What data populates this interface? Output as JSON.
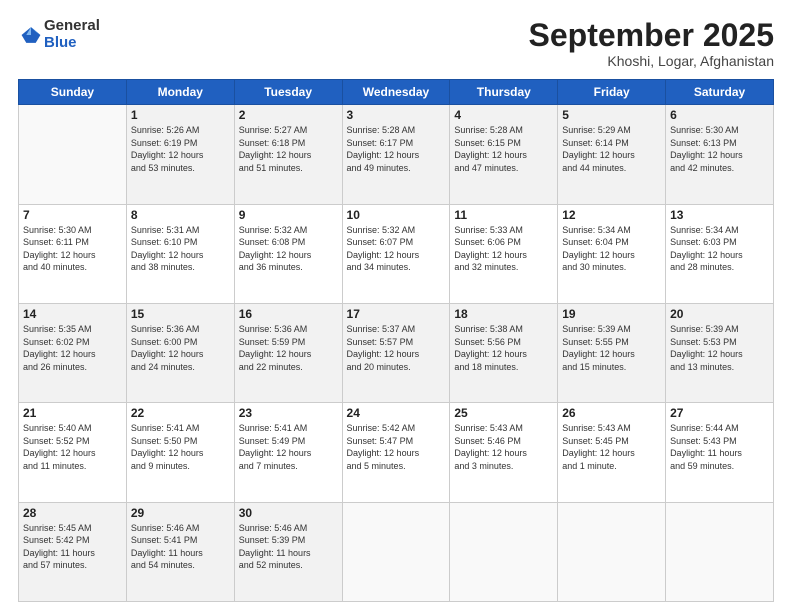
{
  "header": {
    "logo_general": "General",
    "logo_blue": "Blue",
    "month_title": "September 2025",
    "location": "Khoshi, Logar, Afghanistan"
  },
  "days_of_week": [
    "Sunday",
    "Monday",
    "Tuesday",
    "Wednesday",
    "Thursday",
    "Friday",
    "Saturday"
  ],
  "weeks": [
    [
      {
        "day": "",
        "info": ""
      },
      {
        "day": "1",
        "info": "Sunrise: 5:26 AM\nSunset: 6:19 PM\nDaylight: 12 hours\nand 53 minutes."
      },
      {
        "day": "2",
        "info": "Sunrise: 5:27 AM\nSunset: 6:18 PM\nDaylight: 12 hours\nand 51 minutes."
      },
      {
        "day": "3",
        "info": "Sunrise: 5:28 AM\nSunset: 6:17 PM\nDaylight: 12 hours\nand 49 minutes."
      },
      {
        "day": "4",
        "info": "Sunrise: 5:28 AM\nSunset: 6:15 PM\nDaylight: 12 hours\nand 47 minutes."
      },
      {
        "day": "5",
        "info": "Sunrise: 5:29 AM\nSunset: 6:14 PM\nDaylight: 12 hours\nand 44 minutes."
      },
      {
        "day": "6",
        "info": "Sunrise: 5:30 AM\nSunset: 6:13 PM\nDaylight: 12 hours\nand 42 minutes."
      }
    ],
    [
      {
        "day": "7",
        "info": "Sunrise: 5:30 AM\nSunset: 6:11 PM\nDaylight: 12 hours\nand 40 minutes."
      },
      {
        "day": "8",
        "info": "Sunrise: 5:31 AM\nSunset: 6:10 PM\nDaylight: 12 hours\nand 38 minutes."
      },
      {
        "day": "9",
        "info": "Sunrise: 5:32 AM\nSunset: 6:08 PM\nDaylight: 12 hours\nand 36 minutes."
      },
      {
        "day": "10",
        "info": "Sunrise: 5:32 AM\nSunset: 6:07 PM\nDaylight: 12 hours\nand 34 minutes."
      },
      {
        "day": "11",
        "info": "Sunrise: 5:33 AM\nSunset: 6:06 PM\nDaylight: 12 hours\nand 32 minutes."
      },
      {
        "day": "12",
        "info": "Sunrise: 5:34 AM\nSunset: 6:04 PM\nDaylight: 12 hours\nand 30 minutes."
      },
      {
        "day": "13",
        "info": "Sunrise: 5:34 AM\nSunset: 6:03 PM\nDaylight: 12 hours\nand 28 minutes."
      }
    ],
    [
      {
        "day": "14",
        "info": "Sunrise: 5:35 AM\nSunset: 6:02 PM\nDaylight: 12 hours\nand 26 minutes."
      },
      {
        "day": "15",
        "info": "Sunrise: 5:36 AM\nSunset: 6:00 PM\nDaylight: 12 hours\nand 24 minutes."
      },
      {
        "day": "16",
        "info": "Sunrise: 5:36 AM\nSunset: 5:59 PM\nDaylight: 12 hours\nand 22 minutes."
      },
      {
        "day": "17",
        "info": "Sunrise: 5:37 AM\nSunset: 5:57 PM\nDaylight: 12 hours\nand 20 minutes."
      },
      {
        "day": "18",
        "info": "Sunrise: 5:38 AM\nSunset: 5:56 PM\nDaylight: 12 hours\nand 18 minutes."
      },
      {
        "day": "19",
        "info": "Sunrise: 5:39 AM\nSunset: 5:55 PM\nDaylight: 12 hours\nand 15 minutes."
      },
      {
        "day": "20",
        "info": "Sunrise: 5:39 AM\nSunset: 5:53 PM\nDaylight: 12 hours\nand 13 minutes."
      }
    ],
    [
      {
        "day": "21",
        "info": "Sunrise: 5:40 AM\nSunset: 5:52 PM\nDaylight: 12 hours\nand 11 minutes."
      },
      {
        "day": "22",
        "info": "Sunrise: 5:41 AM\nSunset: 5:50 PM\nDaylight: 12 hours\nand 9 minutes."
      },
      {
        "day": "23",
        "info": "Sunrise: 5:41 AM\nSunset: 5:49 PM\nDaylight: 12 hours\nand 7 minutes."
      },
      {
        "day": "24",
        "info": "Sunrise: 5:42 AM\nSunset: 5:47 PM\nDaylight: 12 hours\nand 5 minutes."
      },
      {
        "day": "25",
        "info": "Sunrise: 5:43 AM\nSunset: 5:46 PM\nDaylight: 12 hours\nand 3 minutes."
      },
      {
        "day": "26",
        "info": "Sunrise: 5:43 AM\nSunset: 5:45 PM\nDaylight: 12 hours\nand 1 minute."
      },
      {
        "day": "27",
        "info": "Sunrise: 5:44 AM\nSunset: 5:43 PM\nDaylight: 11 hours\nand 59 minutes."
      }
    ],
    [
      {
        "day": "28",
        "info": "Sunrise: 5:45 AM\nSunset: 5:42 PM\nDaylight: 11 hours\nand 57 minutes."
      },
      {
        "day": "29",
        "info": "Sunrise: 5:46 AM\nSunset: 5:41 PM\nDaylight: 11 hours\nand 54 minutes."
      },
      {
        "day": "30",
        "info": "Sunrise: 5:46 AM\nSunset: 5:39 PM\nDaylight: 11 hours\nand 52 minutes."
      },
      {
        "day": "",
        "info": ""
      },
      {
        "day": "",
        "info": ""
      },
      {
        "day": "",
        "info": ""
      },
      {
        "day": "",
        "info": ""
      }
    ]
  ]
}
